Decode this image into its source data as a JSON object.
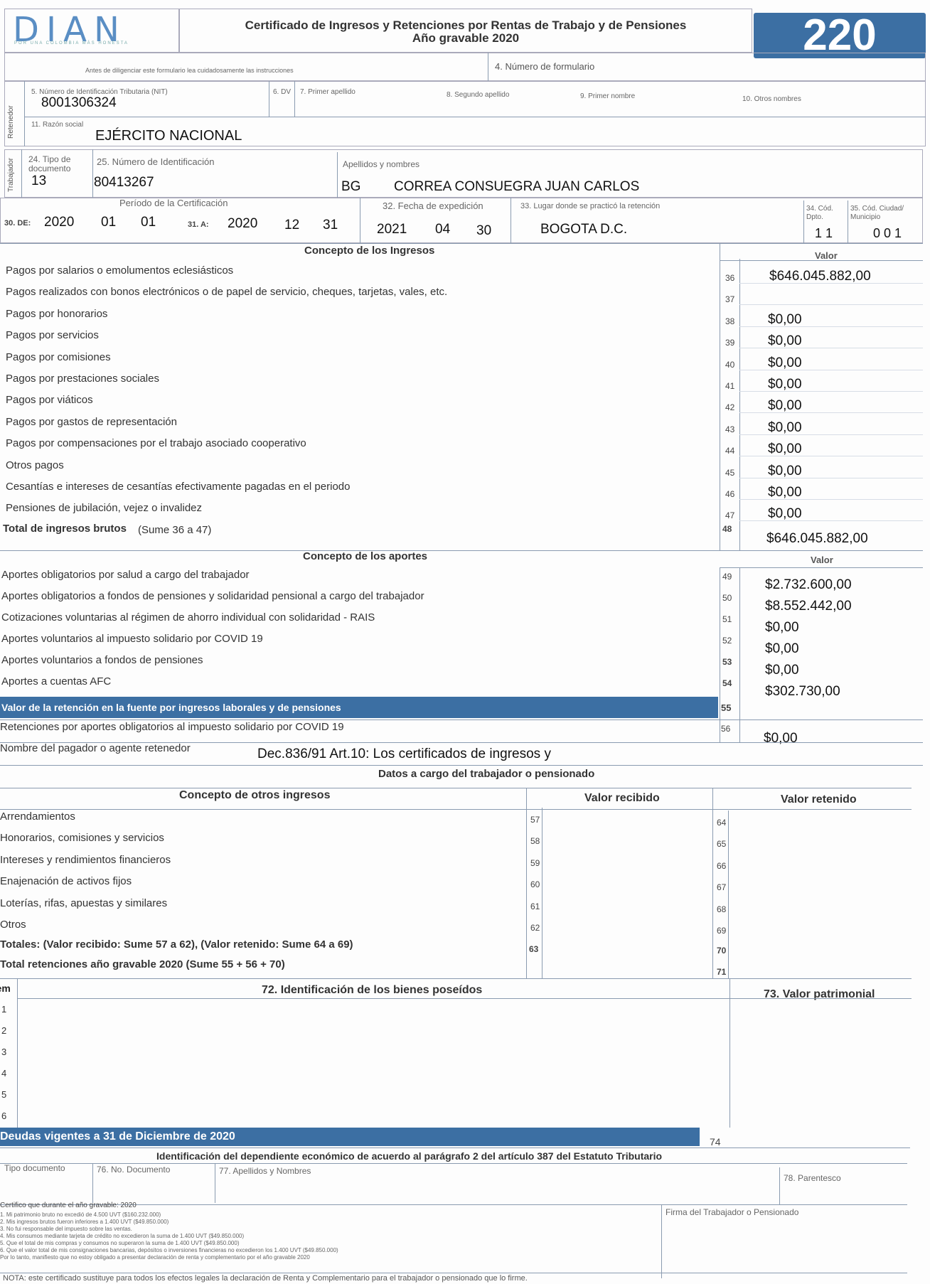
{
  "header": {
    "logo_text": "DIAN",
    "logo_tagline": "POR UNA COLOMBIA MÁS HONESTA",
    "title": "Certificado de Ingresos y Retenciones por Rentas de Trabajo y de Pensiones",
    "subtitle": "Año gravable  2020",
    "form_number": "220",
    "instructions": "Antes de diligenciar este formulario lea cuidadosamente las instrucciones",
    "form_number_label": "4. Número de formulario"
  },
  "retenedor": {
    "side_label": "Retenedor",
    "nit_label": "5. Número de Identificación Tributaria (NIT)",
    "nit": "8001306324",
    "dv_label": "6. DV",
    "primer_apellido_label": "7. Primer apellido",
    "segundo_apellido_label": "8. Segundo apellido",
    "primer_nombre_label": "9. Primer nombre",
    "otros_nombres_label": "10. Otros nombres",
    "razon_social_label": "11. Razón social",
    "razon_social": "EJÉRCITO NACIONAL"
  },
  "trabajador": {
    "side_label": "Trabajador",
    "tipo_doc_label": "24. Tipo de documento",
    "tipo_doc": "13",
    "num_id_label": "25. Número de Identificación",
    "num_id": "80413267",
    "nombres_label": "Apellidos y nombres",
    "prefix": "BG",
    "nombres": "CORREA CONSUEGRA JUAN CARLOS"
  },
  "periodo": {
    "label": "Período de la Certificación",
    "de_label": "30. DE:",
    "de_year": "2020",
    "de_month": "01",
    "de_day": "01",
    "a_label": "31. A:",
    "a_year": "2020",
    "a_month": "12",
    "a_day": "31",
    "fecha_label": "32. Fecha de expedición",
    "fecha_year": "2021",
    "fecha_month": "04",
    "fecha_day": "30",
    "lugar_label": "33. Lugar donde se practicó la retención",
    "lugar": "BOGOTA D.C.",
    "dpto_label": "34. Cód. Dpto.",
    "dpto": "1 1",
    "mpio_label": "35. Cód. Ciudad/ Municipio",
    "mpio": "0 0 1"
  },
  "ingresos": {
    "header": "Concepto de los Ingresos",
    "valor_header": "Valor",
    "rows": [
      {
        "label": "Pagos por salarios o emolumentos eclesiásticos",
        "num": "36",
        "value": "$646.045.882,00"
      },
      {
        "label": "Pagos realizados con bonos electrónicos o de papel de servicio, cheques, tarjetas, vales, etc.",
        "num": "37",
        "value": ""
      },
      {
        "label": "Pagos por honorarios",
        "num": "38",
        "value": "$0,00"
      },
      {
        "label": "Pagos por servicios",
        "num": "39",
        "value": "$0,00"
      },
      {
        "label": "Pagos por comisiones",
        "num": "40",
        "value": "$0,00"
      },
      {
        "label": "Pagos por prestaciones sociales",
        "num": "41",
        "value": "$0,00"
      },
      {
        "label": "Pagos por viáticos",
        "num": "42",
        "value": "$0,00"
      },
      {
        "label": "Pagos por gastos de representación",
        "num": "43",
        "value": "$0,00"
      },
      {
        "label": "Pagos por compensaciones por el trabajo asociado cooperativo",
        "num": "44",
        "value": "$0,00"
      },
      {
        "label": "Otros pagos",
        "num": "45",
        "value": "$0,00"
      },
      {
        "label": "Cesantías e intereses de cesantías efectivamente pagadas en el periodo",
        "num": "46",
        "value": "$0,00"
      },
      {
        "label": "Pensiones de jubilación, vejez o invalidez",
        "num": "47",
        "value": "$0,00"
      }
    ],
    "total_label": "Total de ingresos brutos",
    "total_hint": "(Sume 36 a 47)",
    "total_num": "48",
    "total_value": "$646.045.882,00"
  },
  "aportes": {
    "header": "Concepto de los aportes",
    "valor_header": "Valor",
    "rows": [
      {
        "label": "Aportes obligatorios por salud a cargo del trabajador",
        "num": "49",
        "value": "$2.732.600,00"
      },
      {
        "label": "Aportes obligatorios a fondos de pensiones y solidaridad pensional a cargo del trabajador",
        "num": "50",
        "value": "$8.552.442,00"
      },
      {
        "label": "Cotizaciones voluntarias al régimen de ahorro individual con solidaridad - RAIS",
        "num": "51",
        "value": "$0,00"
      },
      {
        "label": "Aportes voluntarios al impuesto solidario por COVID 19",
        "num": "52",
        "value": "$0,00"
      },
      {
        "label": "Aportes voluntarios a fondos de pensiones",
        "num": "53",
        "value": "$0,00"
      },
      {
        "label": "Aportes a cuentas AFC",
        "num": "54",
        "value": "$302.730,00"
      }
    ],
    "retencion_label": "Valor de la retención en la fuente por ingresos laborales y de pensiones",
    "retencion_num": "55",
    "covid_label": "Retenciones por aportes obligatorios al impuesto solidario por COVID 19",
    "covid_num": "56",
    "covid_value": "$0,00",
    "pagador_label": "Nombre del pagador o agente retenedor",
    "pagador_note": "Dec.836/91 Art.10: Los certificados de ingresos y"
  },
  "otros": {
    "section_title": "Datos a cargo del trabajador o pensionado",
    "header": "Concepto de otros ingresos",
    "recibido_header": "Valor recibido",
    "retenido_header": "Valor retenido",
    "rows": [
      {
        "label": "Arrendamientos",
        "n1": "57",
        "n2": "64"
      },
      {
        "label": "Honorarios, comisiones y servicios",
        "n1": "58",
        "n2": "65"
      },
      {
        "label": "Intereses y rendimientos financieros",
        "n1": "59",
        "n2": "66"
      },
      {
        "label": "Enajenación de activos fijos",
        "n1": "60",
        "n2": "67"
      },
      {
        "label": "Loterías, rifas, apuestas y similares",
        "n1": "61",
        "n2": "68"
      },
      {
        "label": "Otros",
        "n1": "62",
        "n2": "69"
      }
    ],
    "totales_label": "Totales: (Valor recibido: Sume 57 a 62), (Valor retenido: Sume 64 a 69)",
    "totales_n1": "63",
    "totales_n2": "70",
    "total_ret_label": "Total retenciones año gravable 2020 (Sume 55 + 56 + 70)",
    "total_ret_num": "71"
  },
  "bienes": {
    "item_header": "Ítem",
    "ident_header": "72. Identificación de los bienes poseídos",
    "valor_header": "73. Valor patrimonial",
    "items": [
      "1",
      "2",
      "3",
      "4",
      "5",
      "6"
    ]
  },
  "deudas": {
    "label": "Deudas vigentes a 31 de Diciembre de 2020",
    "num": "74"
  },
  "dependiente": {
    "title": "Identificación del dependiente económico de acuerdo al parágrafo 2 del artículo 387 del Estatuto Tributario",
    "tipo_label": "Tipo documento",
    "num_label": "76. No. Documento",
    "nombres_label": "77. Apellidos y Nombres",
    "parentesco_label": "78. Parentesco"
  },
  "footer": {
    "declaro_title": "Certifico que durante el año gravable:   2020",
    "declaro_lines": [
      "1. Mi patrimonio bruto no excedió de 4.500 UVT ($160.232.000)",
      "2. Mis ingresos brutos fueron inferiores a 1.400 UVT ($49.850.000)",
      "3. No fui responsable del impuesto sobre las ventas.",
      "4. Mis consumos mediante tarjeta de crédito no excedieron la suma de 1.400 UVT ($49.850.000)",
      "5. Que el total de mis compras y consumos no superaron la suma de 1.400 UVT ($49.850.000)",
      "6. Que el valor total de mis consignaciones bancarias, depósitos o inversiones financieras no excedieron los 1.400 UVT ($49.850.000)",
      "Por lo tanto, manifiesto que no estoy obligado a presentar declaración de renta y complementario por el año gravable   2020"
    ],
    "firma_label": "Firma del Trabajador o Pensionado",
    "nota": "NOTA: este certificado sustituye para todos los efectos legales la declaración de Renta y Complementario para el trabajador o pensionado que lo firme."
  },
  "colors": {
    "brand_blue": "#3c6fa3",
    "line": "#8a9bb0"
  }
}
